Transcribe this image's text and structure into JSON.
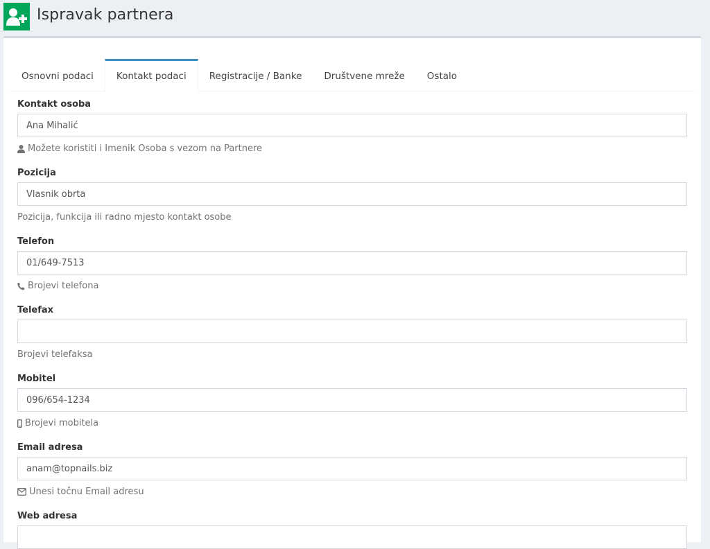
{
  "header": {
    "title": "Ispravak partnera",
    "icon": "user-plus-icon",
    "icon_color": "#00a65a"
  },
  "tabs": [
    {
      "label": "Osnovni podaci",
      "active": false
    },
    {
      "label": "Kontakt podaci",
      "active": true
    },
    {
      "label": "Registracije / Banke",
      "active": false
    },
    {
      "label": "Društvene mreže",
      "active": false
    },
    {
      "label": "Ostalo",
      "active": false
    }
  ],
  "accent_color": "#3c8dbc",
  "fields": {
    "kontakt_osoba": {
      "label": "Kontakt osoba",
      "value": "Ana Mihalić",
      "help": "Možete koristiti i Imenik Osoba s vezom na Partnere",
      "help_icon": "user-icon"
    },
    "pozicija": {
      "label": "Pozicija",
      "value": "Vlasnik obrta",
      "help": "Pozicija, funkcija ili radno mjesto kontakt osobe"
    },
    "telefon": {
      "label": "Telefon",
      "value": "01/649-7513",
      "help": "Brojevi telefona",
      "help_icon": "phone-icon"
    },
    "telefax": {
      "label": "Telefax",
      "value": "",
      "help": "Brojevi telefaksa"
    },
    "mobitel": {
      "label": "Mobitel",
      "value": "096/654-1234",
      "help": "Brojevi mobitela",
      "help_icon": "mobile-icon"
    },
    "email": {
      "label": "Email adresa",
      "value": "anam@topnails.biz",
      "help": "Unesi točnu Email adresu",
      "help_icon": "envelope-icon"
    },
    "web": {
      "label": "Web adresa",
      "value": ""
    }
  }
}
